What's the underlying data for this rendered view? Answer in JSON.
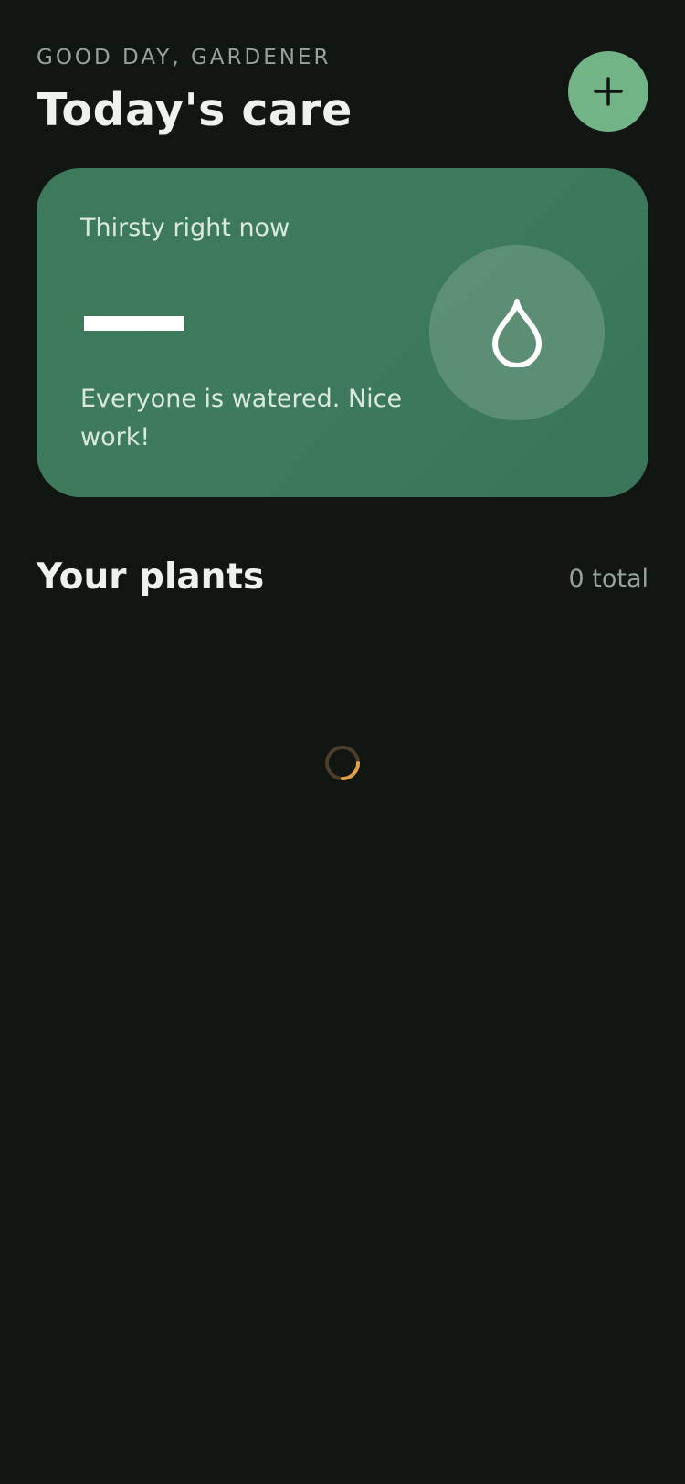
{
  "header": {
    "greeting": "GOOD DAY, GARDENER",
    "title": "Today's care",
    "add_icon": "plus-icon"
  },
  "thirsty_card": {
    "label": "Thirsty right now",
    "count_display": "—",
    "message": "Everyone is watered. Nice work!",
    "icon": "water-drop-icon"
  },
  "plants_section": {
    "title": "Your plants",
    "count": "0 total",
    "loading_icon": "loading-spinner-icon"
  },
  "colors": {
    "background": "#111613",
    "card": "#3c7a5b",
    "accent_button": "#73b487",
    "spinner": "#e0a04a"
  }
}
